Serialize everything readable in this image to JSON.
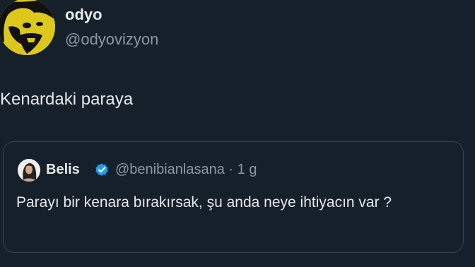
{
  "author": {
    "display_name": "odyo",
    "handle": "@odyovizyon",
    "avatar_icon": "caricature-face-avatar"
  },
  "tweet": {
    "text": "Kenardaki paraya"
  },
  "quoted": {
    "display_name": "Belis",
    "verified_icon": "verified-badge-icon",
    "handle_time": "@benibianlasana · 1 g",
    "text": "Parayı bir kenara bırakırsak, şu anda neye ihtiyacın var ?"
  },
  "colors": {
    "background": "#15202b",
    "primary_text": "#e7e9ea",
    "secondary_text": "#8b98a5",
    "border": "#38444d",
    "verified": "#1d9bf0"
  }
}
